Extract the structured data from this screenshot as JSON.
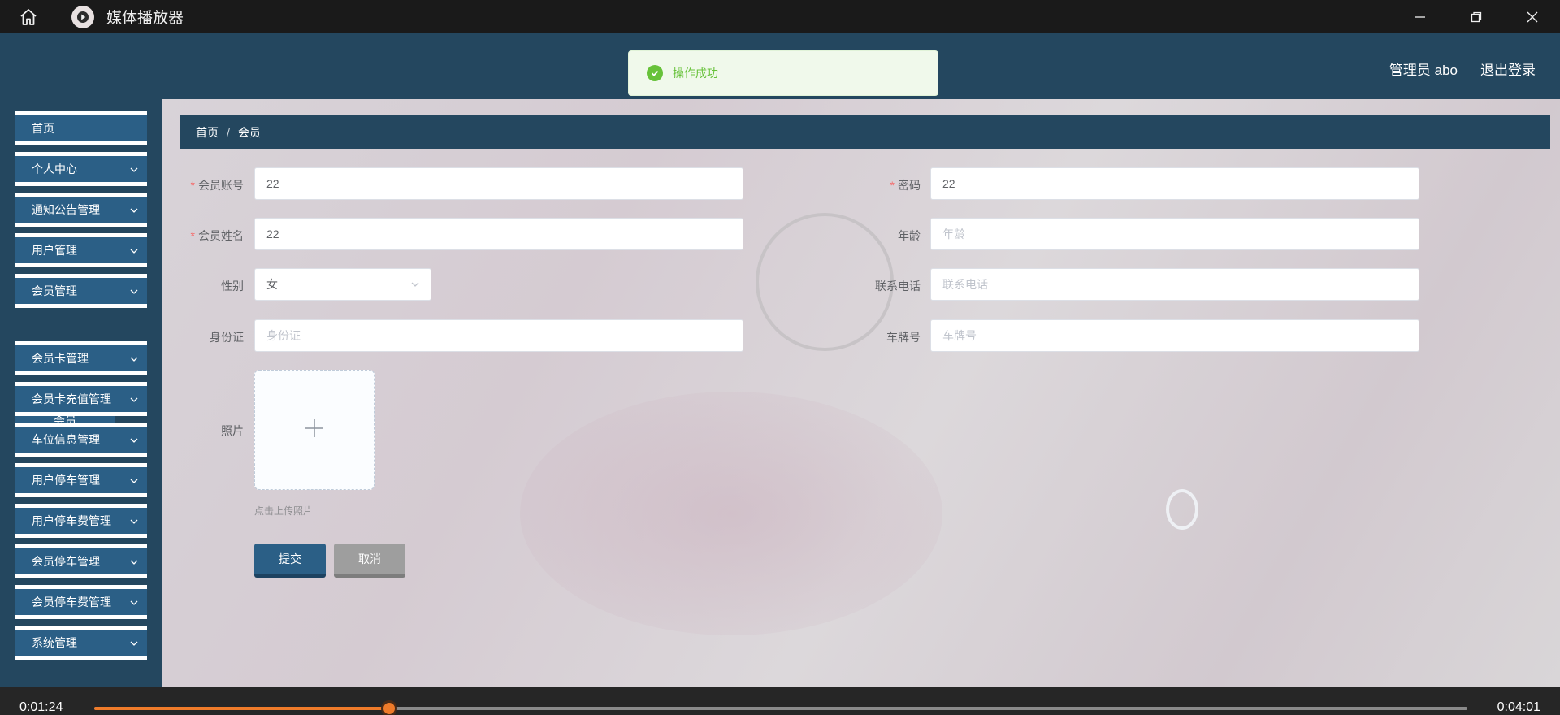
{
  "player": {
    "title": "媒体播放器",
    "icons": {
      "home": "home-icon",
      "logo": "play-icon",
      "minimize": "minimize-icon",
      "restore": "restore-icon",
      "close": "close-icon"
    },
    "elapsed": "0:01:24",
    "total": "0:04:01",
    "progress_fraction": 0.215,
    "accent": "#ef7b2a"
  },
  "header": {
    "user": "管理员 abo",
    "logout": "退出登录",
    "bg": "#24475f"
  },
  "toast": {
    "message": "操作成功",
    "icon": "check-circle-icon",
    "color": "#67c23a"
  },
  "sidebar": {
    "items": [
      {
        "label": "首页",
        "expandable": false
      },
      {
        "label": "个人中心",
        "expandable": true
      },
      {
        "label": "通知公告管理",
        "expandable": true
      },
      {
        "label": "用户管理",
        "expandable": true
      },
      {
        "label": "会员管理",
        "expandable": true
      },
      {
        "label": "会员卡管理",
        "expandable": true
      },
      {
        "label": "会员卡充值管理",
        "expandable": true
      },
      {
        "label": "车位信息管理",
        "expandable": true
      },
      {
        "label": "用户停车管理",
        "expandable": true
      },
      {
        "label": "用户停车费管理",
        "expandable": true
      },
      {
        "label": "会员停车管理",
        "expandable": true
      },
      {
        "label": "会员停车费管理",
        "expandable": true
      },
      {
        "label": "系统管理",
        "expandable": true
      }
    ],
    "sub_item": "会员"
  },
  "breadcrumb": {
    "home": "首页",
    "separator": "/",
    "current": "会员"
  },
  "form": {
    "account": {
      "label": "会员账号",
      "value": "22",
      "required": true
    },
    "password": {
      "label": "密码",
      "value": "22",
      "required": true
    },
    "name": {
      "label": "会员姓名",
      "value": "22",
      "required": true
    },
    "age": {
      "label": "年龄",
      "placeholder": "年龄"
    },
    "gender": {
      "label": "性别",
      "value": "女"
    },
    "phone": {
      "label": "联系电话",
      "placeholder": "联系电话"
    },
    "id_card": {
      "label": "身份证",
      "placeholder": "身份证"
    },
    "plate": {
      "label": "车牌号",
      "placeholder": "车牌号"
    },
    "photo": {
      "label": "照片",
      "tip": "点击上传照片"
    },
    "submit": "提交",
    "cancel": "取消"
  }
}
